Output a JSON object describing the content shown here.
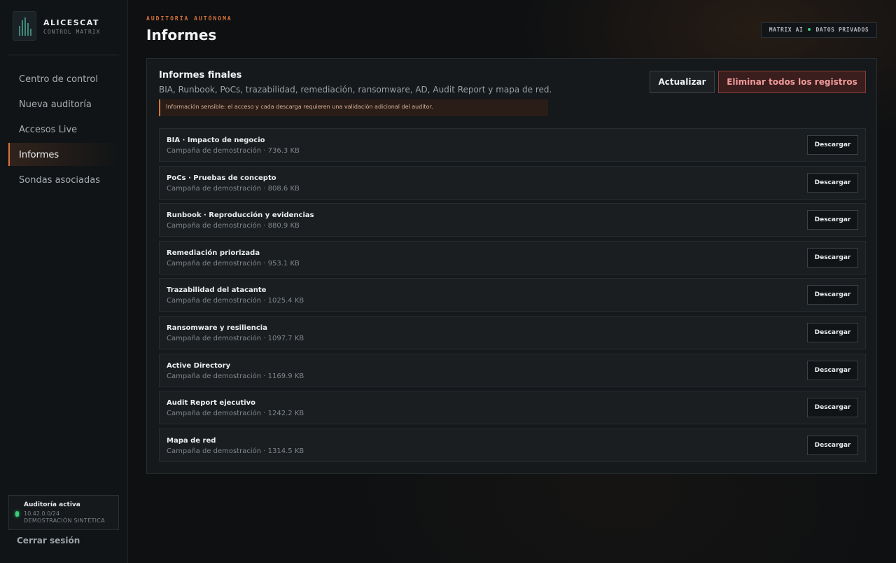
{
  "brand": {
    "name": "ALICESCAT",
    "subtitle": "CONTROL MATRIX"
  },
  "nav": {
    "items": [
      {
        "label": "Centro de control",
        "active": false
      },
      {
        "label": "Nueva auditoría",
        "active": false
      },
      {
        "label": "Accesos Live",
        "active": false
      },
      {
        "label": "Informes",
        "active": true
      },
      {
        "label": "Sondas asociadas",
        "active": false
      }
    ]
  },
  "audit_status": {
    "title": "Auditoría activa",
    "network": "10.42.0.0/24",
    "mode": "DEMOSTRACIÓN SINTÉTICA",
    "status_color": "#38d07a"
  },
  "logout_label": "Cerrar sesión",
  "header": {
    "eyebrow": "AUDITORÍA AUTÓNOMA",
    "title": "Informes",
    "badge_left": "MATRIX AI",
    "badge_right": "DATOS PRIVADOS"
  },
  "panel": {
    "title": "Informes finales",
    "description": "BIA, Runbook, PoCs, trazabilidad, remediación, ransomware, AD, Audit Report y mapa de red.",
    "warning": "Información sensible: el acceso y cada descarga requieren una validación adicional del auditor.",
    "refresh_label": "Actualizar",
    "delete_all_label": "Eliminar todos los registros"
  },
  "download_label": "Descargar",
  "reports": [
    {
      "name": "BIA · Impacto de negocio",
      "meta": "Campaña de demostración · 736.3 KB"
    },
    {
      "name": "PoCs · Pruebas de concepto",
      "meta": "Campaña de demostración · 808.6 KB"
    },
    {
      "name": "Runbook · Reproducción y evidencias",
      "meta": "Campaña de demostración · 880.9 KB"
    },
    {
      "name": "Remediación priorizada",
      "meta": "Campaña de demostración · 953.1 KB"
    },
    {
      "name": "Trazabilidad del atacante",
      "meta": "Campaña de demostración · 1025.4 KB"
    },
    {
      "name": "Ransomware y resiliencia",
      "meta": "Campaña de demostración · 1097.7 KB"
    },
    {
      "name": "Active Directory",
      "meta": "Campaña de demostración · 1169.9 KB"
    },
    {
      "name": "Audit Report ejecutivo",
      "meta": "Campaña de demostración · 1242.2 KB"
    },
    {
      "name": "Mapa de red",
      "meta": "Campaña de demostración · 1314.5 KB"
    }
  ],
  "colors": {
    "accent": "#d9733a",
    "danger": "#f09a9a",
    "ok": "#38d07a"
  }
}
